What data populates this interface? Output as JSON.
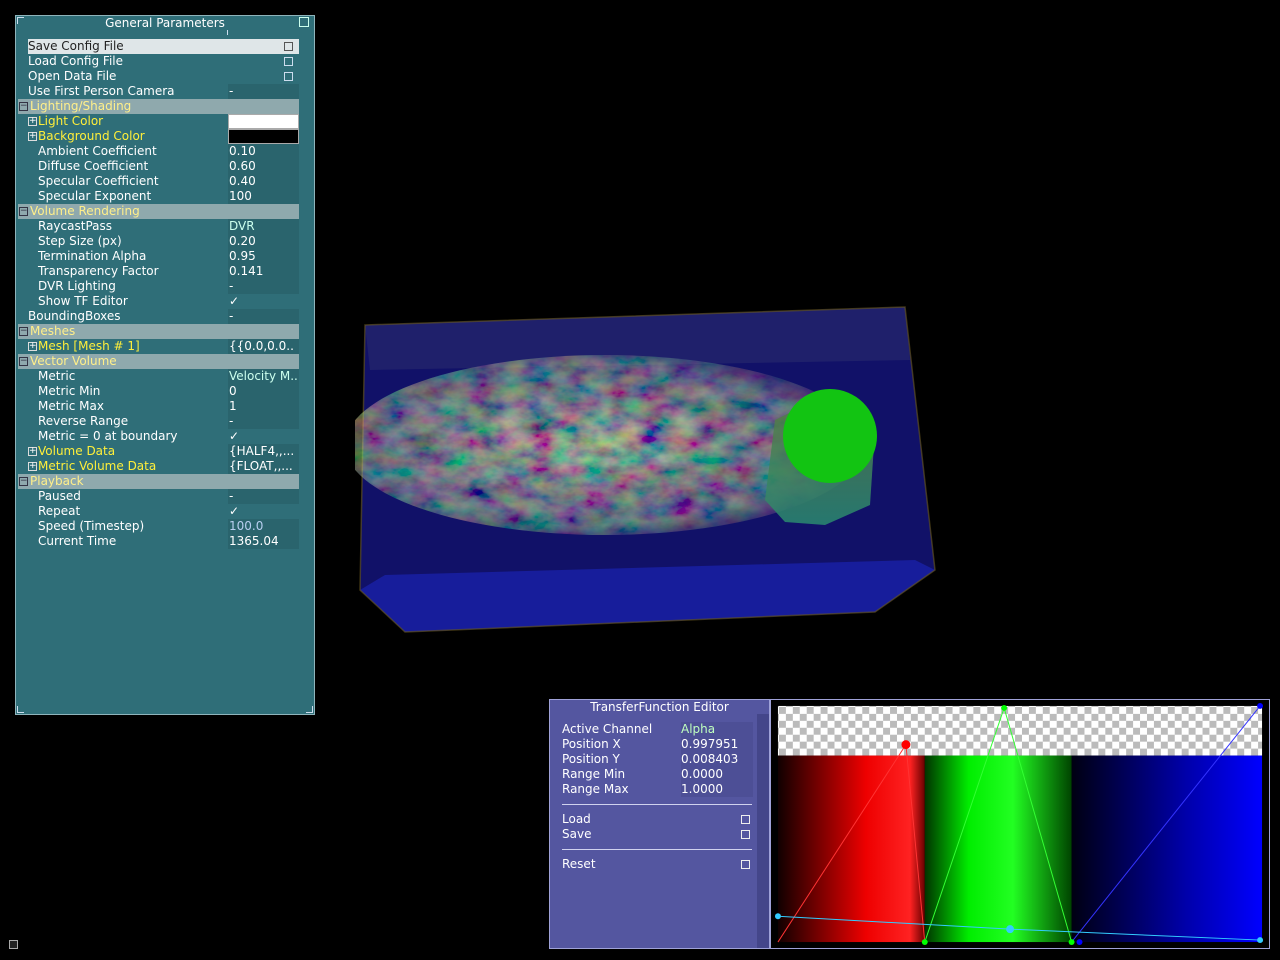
{
  "general_parameters": {
    "title": "General Parameters",
    "rows": [
      {
        "label": "Save Config File",
        "value": "",
        "kind": "action"
      },
      {
        "label": "Load Config File",
        "value": "",
        "kind": "action"
      },
      {
        "label": "Open Data File",
        "value": "",
        "kind": "action"
      },
      {
        "label": "Use First Person Camera",
        "value": "-",
        "kind": "bool"
      },
      {
        "label": "Lighting/Shading",
        "kind": "group"
      },
      {
        "label": "Light Color",
        "value": "",
        "kind": "color-white"
      },
      {
        "label": "Background Color",
        "value": "",
        "kind": "color-black"
      },
      {
        "label": "Ambient Coefficient",
        "value": "0.10"
      },
      {
        "label": "Diffuse Coefficient",
        "value": "0.60"
      },
      {
        "label": "Specular Coefficient",
        "value": "0.40"
      },
      {
        "label": "Specular Exponent",
        "value": "100"
      },
      {
        "label": "Volume Rendering",
        "kind": "group"
      },
      {
        "label": "RaycastPass",
        "value": "DVR"
      },
      {
        "label": "Step Size (px)",
        "value": "0.20"
      },
      {
        "label": "Termination Alpha",
        "value": "0.95"
      },
      {
        "label": "Transparency Factor",
        "value": "0.141"
      },
      {
        "label": "DVR Lighting",
        "value": "-"
      },
      {
        "label": "Show TF Editor",
        "value": "✓"
      },
      {
        "label": "BoundingBoxes",
        "value": "-"
      },
      {
        "label": "Meshes",
        "kind": "group"
      },
      {
        "label": "Mesh [Mesh # 1]",
        "value": "{{0.0,0.0.."
      },
      {
        "label": "Vector Volume",
        "kind": "group"
      },
      {
        "label": "Metric",
        "value": "Velocity M.."
      },
      {
        "label": "Metric Min",
        "value": "0"
      },
      {
        "label": "Metric Max",
        "value": "1"
      },
      {
        "label": "Reverse Range",
        "value": "-"
      },
      {
        "label": "Metric = 0 at boundary",
        "value": "✓"
      },
      {
        "label": "Volume Data",
        "value": "{HALF4,,..."
      },
      {
        "label": "Metric Volume Data",
        "value": "{FLOAT,,..."
      },
      {
        "label": "Playback",
        "kind": "group"
      },
      {
        "label": "Paused",
        "value": "-"
      },
      {
        "label": "Repeat",
        "value": "✓"
      },
      {
        "label": "Speed (Timestep)",
        "value": "100.0"
      },
      {
        "label": "Current Time",
        "value": "1365.04"
      }
    ]
  },
  "tf_editor": {
    "title": "TransferFunction Editor",
    "active_channel_label": "Active Channel",
    "active_channel": "Alpha",
    "position_x_label": "Position X",
    "position_x": "0.997951",
    "position_y_label": "Position Y",
    "position_y": "0.008403",
    "range_min_label": "Range Min",
    "range_min": "0.0000",
    "range_max_label": "Range Max",
    "range_max": "1.0000",
    "load_label": "Load",
    "save_label": "Save",
    "reset_label": "Reset"
  },
  "colors": {
    "panel": "#2f6e78",
    "group_header": "#8fa9ad",
    "highlight": "#ffef3a",
    "tf_panel": "#5456a0"
  }
}
